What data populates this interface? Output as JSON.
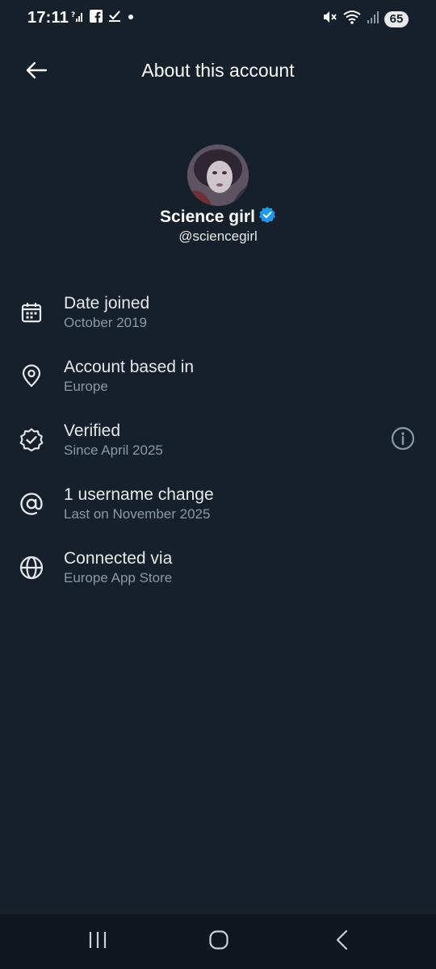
{
  "status_bar": {
    "time": "17:11",
    "battery": "65",
    "left_icons": [
      "signal-unknown-icon",
      "facebook-icon",
      "check-notification-icon",
      "dot-icon"
    ],
    "right_icons": [
      "mute-icon",
      "wifi-icon",
      "cell-signal-icon",
      "battery-icon"
    ]
  },
  "header": {
    "title": "About this account",
    "back_icon": "arrow-left-icon"
  },
  "profile": {
    "name": "Science girl",
    "handle": "@sciencegirl",
    "verified_icon": "verified-badge-icon",
    "verified_color": "#1d9bf0"
  },
  "info": [
    {
      "icon": "calendar-icon",
      "title": "Date joined",
      "subtitle": "October 2019"
    },
    {
      "icon": "location-pin-icon",
      "title": "Account based in",
      "subtitle": "Europe"
    },
    {
      "icon": "verified-check-icon",
      "title": "Verified",
      "subtitle": "Since April 2025",
      "action_icon": "info-icon"
    },
    {
      "icon": "at-sign-icon",
      "title": "1 username change",
      "subtitle": "Last on November 2025"
    },
    {
      "icon": "globe-icon",
      "title": "Connected via",
      "subtitle": "Europe App Store"
    }
  ],
  "nav_bar": {
    "items": [
      "recent-apps-icon",
      "home-icon",
      "back-icon"
    ]
  },
  "colors": {
    "background": "#15202b",
    "text_primary": "#e7e9ea",
    "text_secondary": "#8b98a5",
    "accent": "#1d9bf0"
  }
}
